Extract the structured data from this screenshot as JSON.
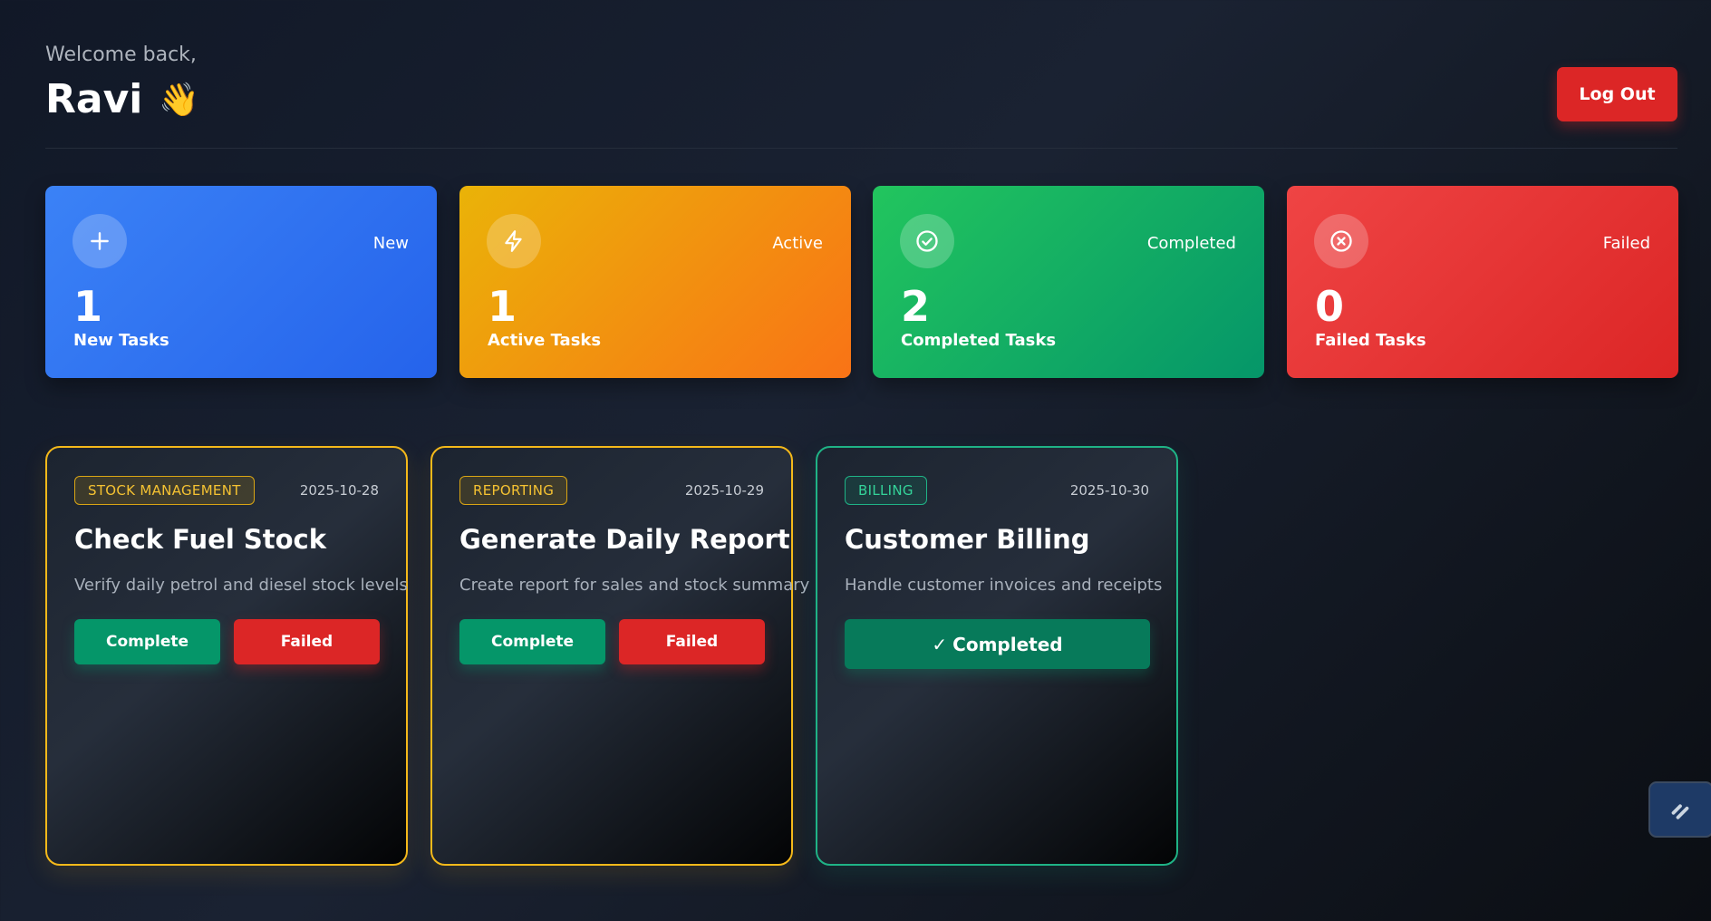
{
  "header": {
    "welcome": "Welcome back,",
    "name": "Ravi",
    "wave_emoji": "👋",
    "logout_label": "Log Out"
  },
  "stats": [
    {
      "tag": "New",
      "count": "1",
      "label": "New Tasks",
      "icon": "plus-icon",
      "color": "#2563eb"
    },
    {
      "tag": "Active",
      "count": "1",
      "label": "Active Tasks",
      "icon": "lightning-icon",
      "color": "#f97316"
    },
    {
      "tag": "Completed",
      "count": "2",
      "label": "Completed Tasks",
      "icon": "check-circle-icon",
      "color": "#059669"
    },
    {
      "tag": "Failed",
      "count": "0",
      "label": "Failed Tasks",
      "icon": "x-circle-icon",
      "color": "#dc2626"
    }
  ],
  "tasks": [
    {
      "category": "STOCK MANAGEMENT",
      "date": "2025-10-28",
      "title": "Check Fuel Stock",
      "description": "Verify daily petrol and diesel stock levels",
      "complete_label": "Complete",
      "failed_label": "Failed"
    },
    {
      "category": "REPORTING",
      "date": "2025-10-29",
      "title": "Generate Daily Report",
      "description": "Create report for sales and stock summary",
      "complete_label": "Complete",
      "failed_label": "Failed"
    },
    {
      "category": "BILLING",
      "date": "2025-10-30",
      "title": "Customer Billing",
      "description": "Handle customer invoices and receipts",
      "completed_label": "Completed",
      "completed_mark": "✓"
    }
  ],
  "colors": {
    "accent_yellow": "#f5b91a",
    "accent_green": "#1fb386",
    "danger": "#dc2626",
    "success": "#059669"
  }
}
